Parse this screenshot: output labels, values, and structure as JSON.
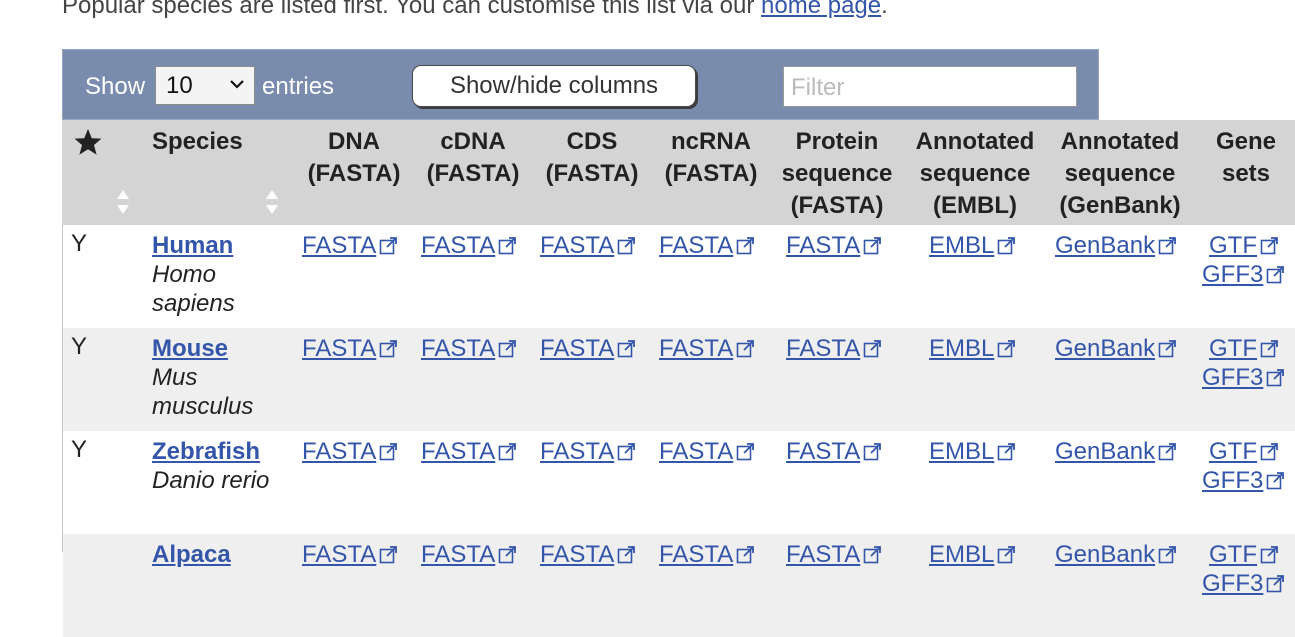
{
  "intro": {
    "text": "Popular species are listed first. You can customise this list via our",
    "link_label": "home page",
    "end": "."
  },
  "controls": {
    "show_label": "Show",
    "page_size": "10",
    "entries_label": "entries",
    "columns_button": "Show/hide columns",
    "filter_placeholder": "Filter"
  },
  "columns": [
    {
      "line1": "Species"
    },
    {
      "line1": "DNA",
      "line2": "(FASTA)"
    },
    {
      "line1": "cDNA",
      "line2": "(FASTA)"
    },
    {
      "line1": "CDS",
      "line2": "(FASTA)"
    },
    {
      "line1": "ncRNA",
      "line2": "(FASTA)"
    },
    {
      "line1": "Protein",
      "line2": "sequence",
      "line3": "(FASTA)"
    },
    {
      "line1": "Annotated",
      "line2": "sequence",
      "line3": "(EMBL)"
    },
    {
      "line1": "Annotated",
      "line2": "sequence",
      "line3": "(GenBank)"
    },
    {
      "line1": "Gene",
      "line2": "sets"
    }
  ],
  "rows": [
    {
      "fav": "Y",
      "common": "Human",
      "sci1": "Homo",
      "sci2": "sapiens"
    },
    {
      "fav": "Y",
      "common": "Mouse",
      "sci1": "Mus",
      "sci2": "musculus"
    },
    {
      "fav": "Y",
      "common": "Zebrafish",
      "sci1": "Danio rerio",
      "sci2": ""
    },
    {
      "fav": "",
      "common": "Alpaca",
      "sci1": "",
      "sci2": ""
    }
  ],
  "links": {
    "fasta": "FASTA",
    "embl": "EMBL",
    "genbank": "GenBank",
    "gtf": "GTF",
    "gff3": "GFF3"
  },
  "colors": {
    "header_bar": "#7a8cad",
    "table_head": "#d4d4d4",
    "row_shade": "#efefef",
    "link": "#3355aa"
  },
  "icons": {
    "favourite_column": "star-icon",
    "sort": "sort-icon",
    "external_link": "external-link-icon",
    "select": "chevron-down-icon"
  }
}
